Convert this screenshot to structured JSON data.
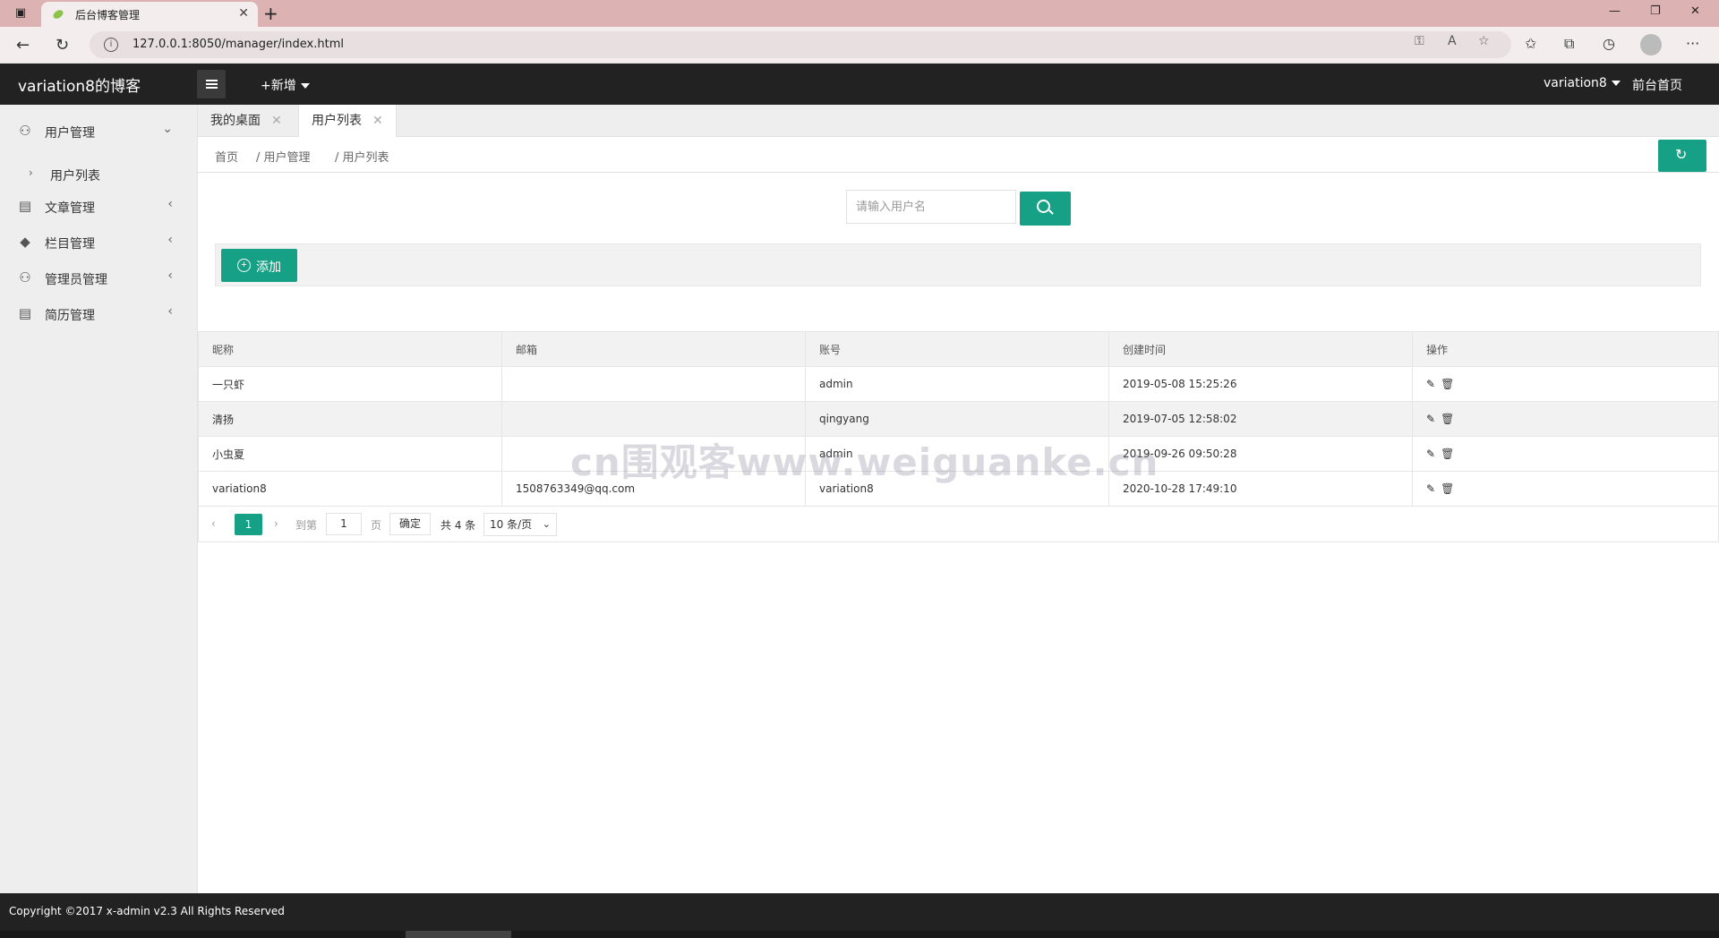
{
  "browser": {
    "tab_title": "后台博客管理",
    "url": "127.0.0.1:8050/manager/index.html"
  },
  "header": {
    "logo": "variation8的博客",
    "new_menu": "+新增",
    "user": "variation8",
    "front_link": "前台首页"
  },
  "sidebar": {
    "items": [
      {
        "label": "用户管理",
        "icon": "user-icon"
      },
      {
        "label": "文章管理",
        "icon": "document-icon"
      },
      {
        "label": "栏目管理",
        "icon": "diamond-icon"
      },
      {
        "label": "管理员管理",
        "icon": "admin-icon"
      },
      {
        "label": "简历管理",
        "icon": "resume-icon"
      }
    ],
    "sub_item": "用户列表"
  },
  "tabs": [
    {
      "label": "我的桌面"
    },
    {
      "label": "用户列表"
    }
  ],
  "breadcrumb": [
    "首页",
    "/ 用户管理",
    "/ 用户列表"
  ],
  "search": {
    "placeholder": "请输入用户名"
  },
  "toolbar": {
    "add_label": "添加"
  },
  "table": {
    "headers": [
      "昵称",
      "邮箱",
      "账号",
      "创建时间",
      "操作"
    ],
    "rows": [
      [
        "一只虾",
        "",
        "admin",
        "2019-05-08 15:25:26"
      ],
      [
        "清扬",
        "",
        "qingyang",
        "2019-07-05 12:58:02"
      ],
      [
        "小虫夏",
        "",
        "admin",
        "2019-09-26 09:50:28"
      ],
      [
        "variation8",
        "1508763349@qq.com",
        "variation8",
        "2020-10-28 17:49:10"
      ]
    ]
  },
  "pager": {
    "current": "1",
    "goto_label": "到第",
    "goto_value": "1",
    "page_label": "页",
    "confirm": "确定",
    "total": "共 4 条",
    "page_size": "10 条/页"
  },
  "watermark": "cn围观客www.weiguanke.cn",
  "footer": {
    "copyright": "Copyright ©2017 x-admin v2.3 All Rights Reserved"
  },
  "colors": {
    "accent": "#16a085",
    "header_bg": "#222222",
    "sidebar_bg": "#eeeeee"
  }
}
